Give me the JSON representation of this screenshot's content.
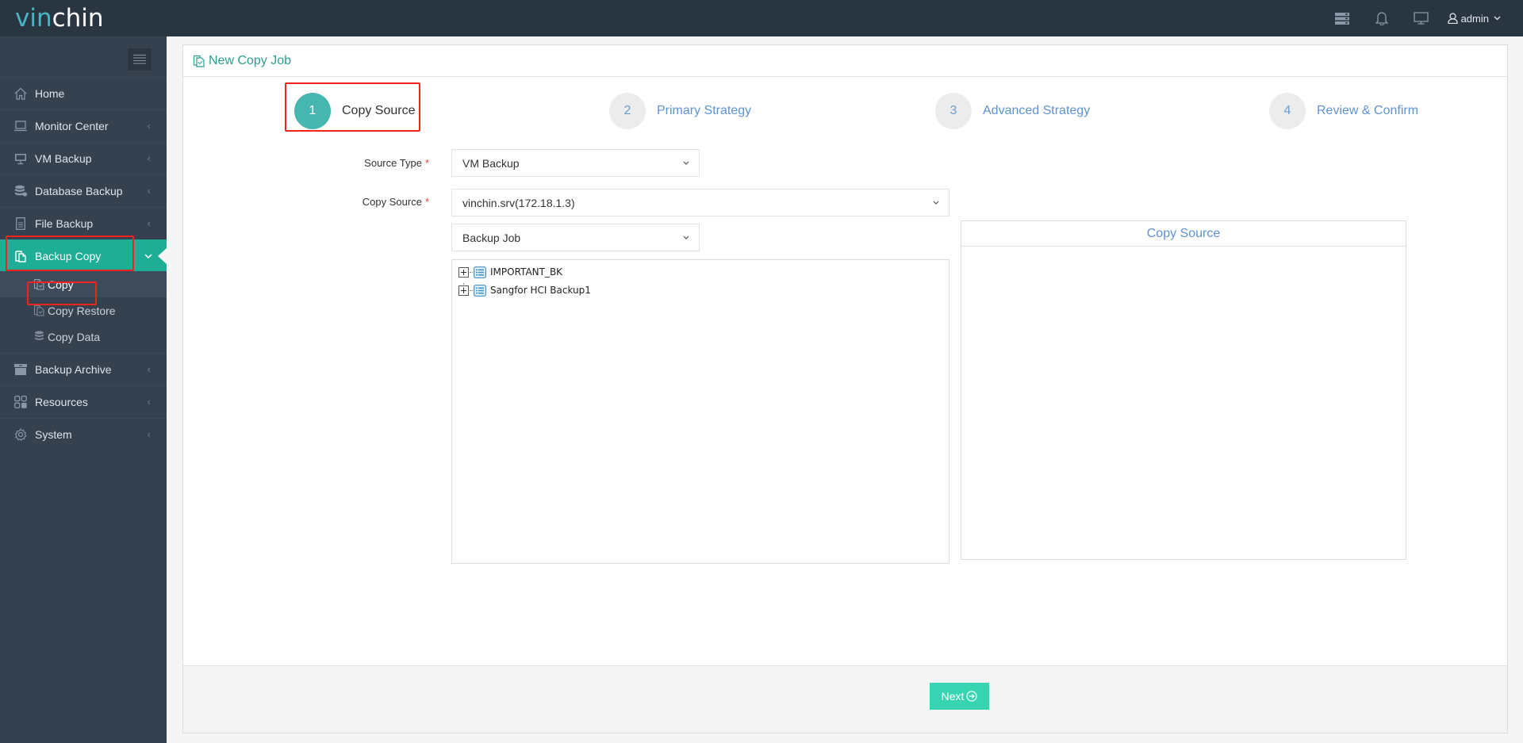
{
  "app": {
    "logo_part1": "vin",
    "logo_part2": "chin"
  },
  "topbar": {
    "icons": [
      "server-icon",
      "bell-icon",
      "monitor-icon"
    ],
    "user_name": "admin"
  },
  "sidebar": {
    "items": [
      {
        "label": "Home",
        "icon": "home-icon",
        "has_arrow": false
      },
      {
        "label": "Monitor Center",
        "icon": "laptop-icon",
        "has_arrow": true
      },
      {
        "label": "VM Backup",
        "icon": "desktop-icon",
        "has_arrow": true
      },
      {
        "label": "Database Backup",
        "icon": "database-icon",
        "has_arrow": true
      },
      {
        "label": "File Backup",
        "icon": "file-icon",
        "has_arrow": true
      },
      {
        "label": "Backup Copy",
        "icon": "copy-icon",
        "has_arrow": true,
        "active": true,
        "expanded": true
      },
      {
        "label": "Backup Archive",
        "icon": "archive-icon",
        "has_arrow": true
      },
      {
        "label": "Resources",
        "icon": "grid-icon",
        "has_arrow": true
      },
      {
        "label": "System",
        "icon": "gear-icon",
        "has_arrow": true
      }
    ],
    "subitems": [
      {
        "label": "Copy",
        "icon": "copy-icon",
        "active": true
      },
      {
        "label": "Copy Restore",
        "icon": "copy-restore-icon"
      },
      {
        "label": "Copy Data",
        "icon": "database-icon"
      }
    ]
  },
  "panel": {
    "title": "New Copy Job",
    "steps": [
      {
        "number": "1",
        "label": "Copy Source",
        "state": "current"
      },
      {
        "number": "2",
        "label": "Primary Strategy",
        "state": "todo"
      },
      {
        "number": "3",
        "label": "Advanced Strategy",
        "state": "todo"
      },
      {
        "number": "4",
        "label": "Review & Confirm",
        "state": "todo"
      }
    ],
    "form": {
      "source_type_label": "Source Type",
      "source_type_value": "VM Backup",
      "copy_source_label": "Copy Source",
      "copy_source_value": "vinchin.srv(172.18.1.3)",
      "filter_value": "Backup Job",
      "required_mark": "*"
    },
    "tree": [
      {
        "label": "IMPORTANT_BK"
      },
      {
        "label": "Sangfor HCI Backup1"
      }
    ],
    "target_title": "Copy Source",
    "next_label": "Next"
  },
  "colors": {
    "topbar": "#2a3542",
    "sidebar": "#364150",
    "accent": "#1eae96",
    "step_current": "#47b5b0",
    "step_todo_text": "#5d93d1",
    "next_button": "#37d4b2",
    "highlight_box": "#f2231f"
  }
}
